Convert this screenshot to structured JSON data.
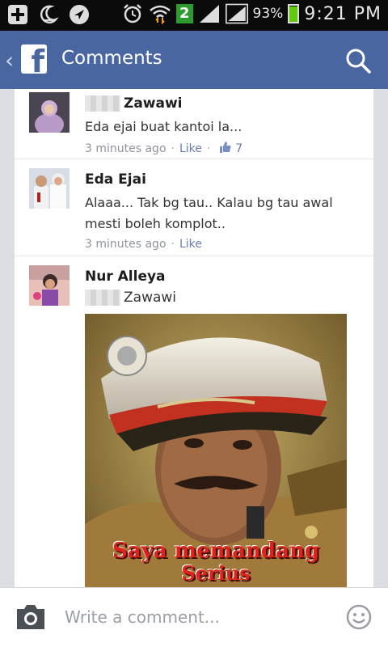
{
  "status": {
    "notification_count": "2",
    "battery_level": 0.93,
    "battery_text": "93%",
    "time": "9:21 PM"
  },
  "header": {
    "title": "Comments",
    "logo_letter": "f"
  },
  "comments": [
    {
      "name": "Zawawi",
      "name_blurred_prefix": true,
      "text": "Eda ejai buat kantoi la...",
      "time": "3 minutes ago",
      "like_label": "Like",
      "like_count": "7"
    },
    {
      "name": "Eda Ejai",
      "text_line1": "Alaaa... Tak bg tau.. Kalau bg tau awal",
      "text_line2": "mesti boleh komplot..",
      "time": "3 minutes ago",
      "like_label": "Like"
    },
    {
      "name": "Nur Alleya",
      "mention": "Zawawi",
      "photo_caption_line1": "Saya memandang",
      "photo_caption_line2": "Serius"
    }
  ],
  "composer": {
    "placeholder": "Write a comment..."
  },
  "colors": {
    "facebook_blue": "#4a66a0",
    "link": "#6b7db0",
    "meta_gray": "#8f949c"
  }
}
